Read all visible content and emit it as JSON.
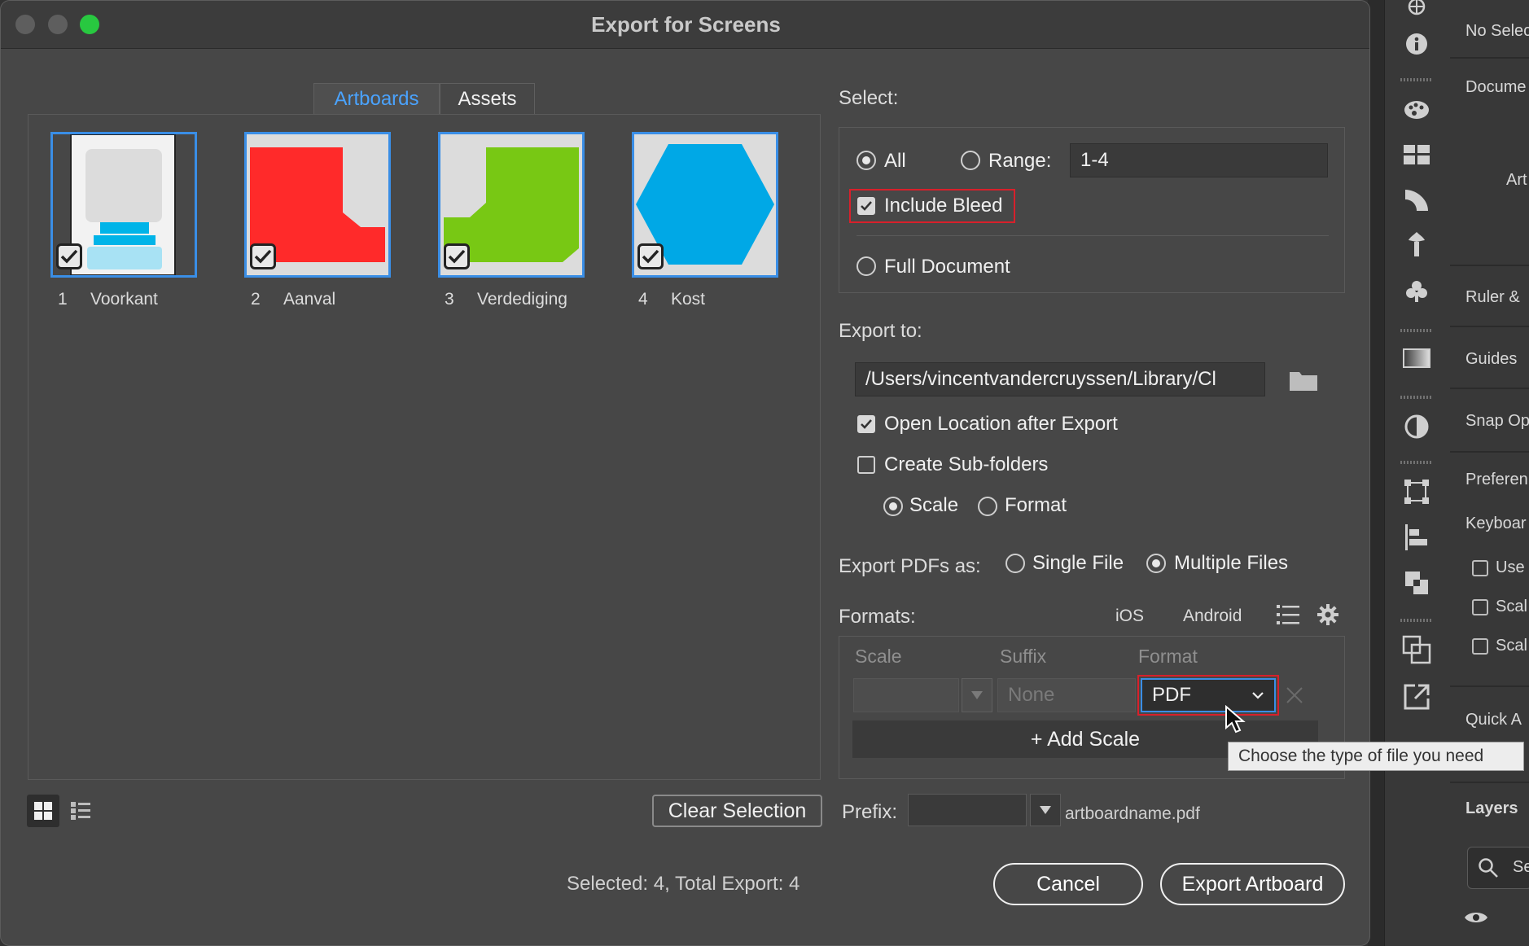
{
  "dialog": {
    "title": "Export for Screens",
    "tabs": [
      {
        "label": "Artboards",
        "active": true
      },
      {
        "label": "Assets",
        "active": false
      }
    ],
    "artboards": [
      {
        "number": "1",
        "name": "Voorkant",
        "checked": true
      },
      {
        "number": "2",
        "name": "Aanval",
        "checked": true
      },
      {
        "number": "3",
        "name": "Verdediging",
        "checked": true
      },
      {
        "number": "4",
        "name": "Kost",
        "checked": true
      }
    ],
    "clear_selection_label": "Clear Selection",
    "status_text": "Selected: 4, Total Export: 4",
    "cancel_label": "Cancel",
    "export_label": "Export Artboard"
  },
  "select": {
    "label": "Select:",
    "all_label": "All",
    "range_label": "Range:",
    "range_value": "1-4",
    "include_bleed_label": "Include Bleed",
    "full_document_label": "Full Document"
  },
  "export_to": {
    "label": "Export to:",
    "path": "/Users/vincentvandercruyssen/Library/Cl",
    "open_location_label": "Open Location after Export",
    "sub_folders_label": "Create Sub-folders",
    "scale_label": "Scale",
    "format_label": "Format"
  },
  "export_pdfs": {
    "label": "Export PDFs as:",
    "single_label": "Single File",
    "multiple_label": "Multiple Files"
  },
  "formats": {
    "label": "Formats:",
    "ios_label": "iOS",
    "android_label": "Android",
    "col_scale": "Scale",
    "col_suffix": "Suffix",
    "col_format": "Format",
    "suffix_placeholder": "None",
    "format_value": "PDF",
    "add_scale_label": "+ Add Scale",
    "tooltip": "Choose the type of file you need"
  },
  "prefix": {
    "label": "Prefix:",
    "filename": "artboardname.pdf"
  },
  "properties_panel": {
    "no_selection": "No Selec",
    "document": "Docume",
    "artboards": "Art",
    "ruler": "Ruler &",
    "guides": "Guides",
    "snap": "Snap Op",
    "preferences": "Preferen",
    "keyboard": "Keyboar",
    "use": "Use",
    "scale1": "Scal",
    "scale2": "Scal",
    "quick_actions": "Quick A",
    "layers": "Layers",
    "search": "Se"
  },
  "colors": {
    "accent": "#3a8ee6",
    "highlight_red": "#d8202b",
    "artboard_red": "#ff2a2a",
    "artboard_green": "#78c814",
    "artboard_blue": "#00a8e6"
  }
}
